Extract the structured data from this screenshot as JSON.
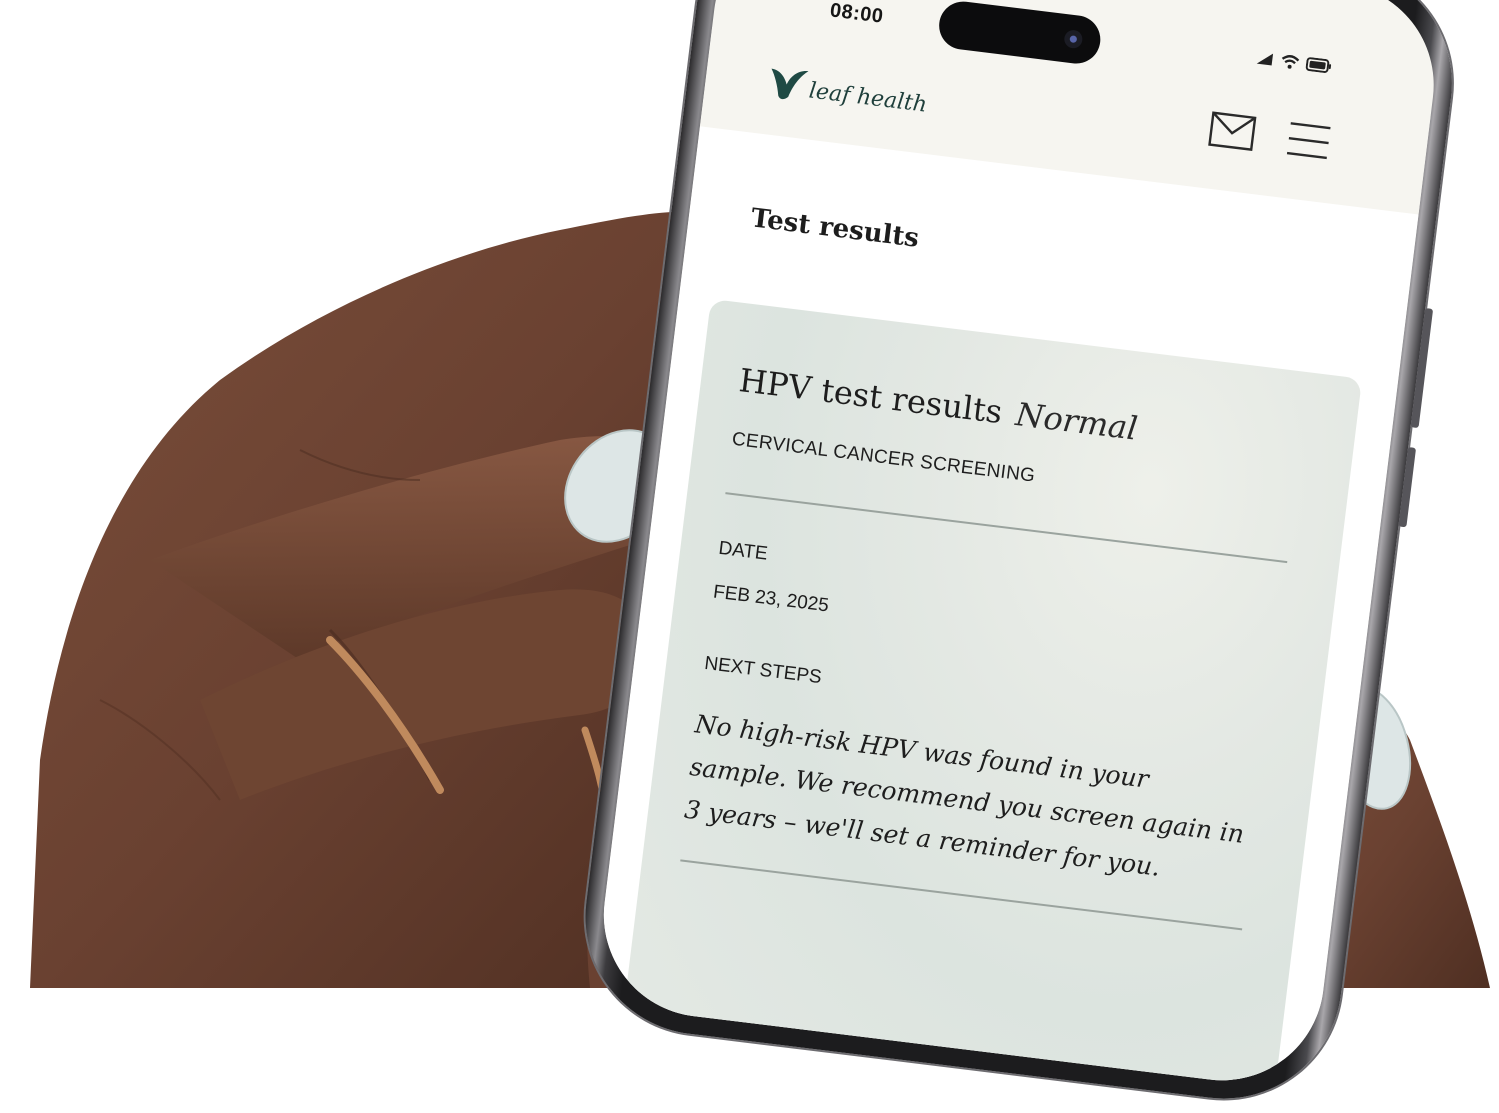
{
  "status_bar": {
    "time": "08:00"
  },
  "header": {
    "logo_text": "leaf health"
  },
  "page": {
    "title": "Test results"
  },
  "result_card": {
    "title": "HPV test results",
    "status": "Normal",
    "category": "CERVICAL CANCER SCREENING",
    "date_label": "DATE",
    "date_value": "FEB 23, 2025",
    "next_steps_label": "NEXT STEPS",
    "next_steps_text": "No high-risk HPV was found in your sample. We recommend you screen again in 3 years – we'll set a reminder for you."
  },
  "colors": {
    "brand": "#1f4a44",
    "card_bg": "#e1e7e2",
    "skin": "#6b4433",
    "nail": "#dde6e6"
  }
}
